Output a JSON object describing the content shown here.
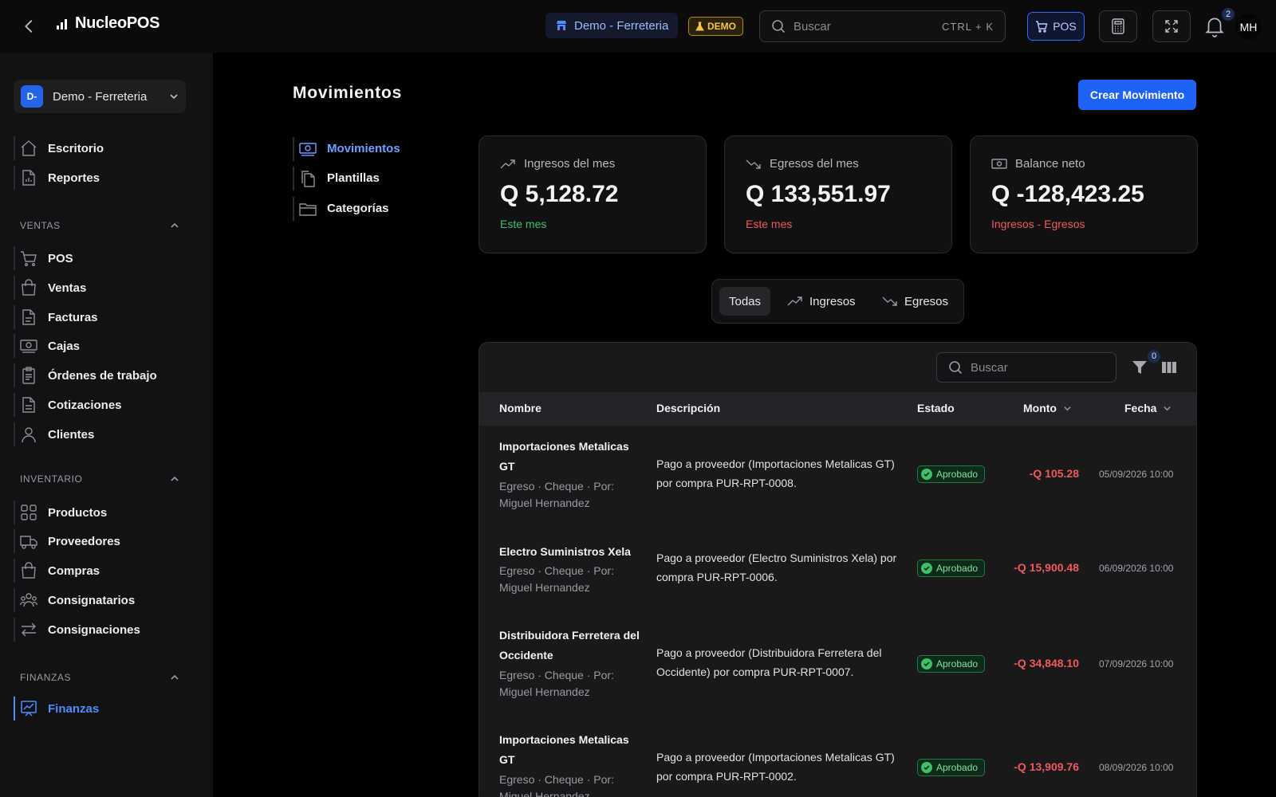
{
  "topbar": {
    "brand": "NucleoPOS",
    "store": "Demo - Ferreteria",
    "demo_badge": "DEMO",
    "search_placeholder": "Buscar",
    "shortcut": "CTRL + K",
    "pos_label": "POS",
    "notifications": "2",
    "avatar": "MH"
  },
  "sidebar": {
    "company": {
      "initials": "D-",
      "name": "Demo - Ferreteria"
    },
    "top_items": [
      {
        "label": "Escritorio",
        "icon": "home-icon"
      },
      {
        "label": "Reportes",
        "icon": "report-icon"
      }
    ],
    "sections": [
      {
        "title": "VENTAS",
        "items": [
          {
            "label": "POS",
            "icon": "cart-icon"
          },
          {
            "label": "Ventas",
            "icon": "bag-icon"
          },
          {
            "label": "Facturas",
            "icon": "invoice-icon"
          },
          {
            "label": "Cajas",
            "icon": "cash-icon"
          },
          {
            "label": "Órdenes de trabajo",
            "icon": "clipboard-icon"
          },
          {
            "label": "Cotizaciones",
            "icon": "document-icon"
          },
          {
            "label": "Clientes",
            "icon": "user-icon"
          }
        ]
      },
      {
        "title": "INVENTARIO",
        "items": [
          {
            "label": "Productos",
            "icon": "grid-icon"
          },
          {
            "label": "Proveedores",
            "icon": "truck-icon"
          },
          {
            "label": "Compras",
            "icon": "bag-icon"
          },
          {
            "label": "Consignatarios",
            "icon": "users-icon"
          },
          {
            "label": "Consignaciones",
            "icon": "arrows-icon"
          }
        ]
      },
      {
        "title": "FINANZAS",
        "items": [
          {
            "label": "Finanzas",
            "icon": "chart-icon"
          }
        ]
      }
    ]
  },
  "page": {
    "title": "Movimientos",
    "create_button": "Crear Movimiento",
    "subnav": [
      {
        "label": "Movimientos",
        "icon": "cash-icon",
        "active": true
      },
      {
        "label": "Plantillas",
        "icon": "copy-icon"
      },
      {
        "label": "Categorías",
        "icon": "folder-icon"
      }
    ]
  },
  "stats": [
    {
      "label": "Ingresos del mes",
      "value": "Q 5,128.72",
      "note": "Este mes",
      "note_color": "#3fbf6a",
      "icon": "trend-up-icon"
    },
    {
      "label": "Egresos del mes",
      "value": "Q 133,551.97",
      "note": "Este mes",
      "note_color": "#ef5a5a",
      "icon": "trend-down-icon"
    },
    {
      "label": "Balance neto",
      "value": "Q -128,423.25",
      "note": "Ingresos - Egresos",
      "note_color": "#ef5a5a",
      "icon": "cash-icon"
    }
  ],
  "filter_tabs": [
    "Todas",
    "Ingresos",
    "Egresos"
  ],
  "table": {
    "search_placeholder": "Buscar",
    "filter_count": "0",
    "columns": [
      "Nombre",
      "Descripción",
      "Estado",
      "Monto",
      "Fecha"
    ],
    "rows": [
      {
        "name": "Importaciones Metalicas GT",
        "meta": "Egreso · Cheque · Por: Miguel Hernandez",
        "description": "Pago a proveedor (Importaciones Metalicas GT) por compra PUR-RPT-0008.",
        "status": "Aprobado",
        "amount": "-Q 105.28",
        "date": "05/09/2026 10:00"
      },
      {
        "name": "Electro Suministros Xela",
        "meta": "Egreso · Cheque · Por: Miguel Hernandez",
        "description": "Pago a proveedor (Electro Suministros Xela) por compra PUR-RPT-0006.",
        "status": "Aprobado",
        "amount": "-Q 15,900.48",
        "date": "06/09/2026 10:00"
      },
      {
        "name": "Distribuidora Ferretera del Occidente",
        "meta": "Egreso · Cheque · Por: Miguel Hernandez",
        "description": "Pago a proveedor (Distribuidora Ferretera del Occidente) por compra PUR-RPT-0007.",
        "status": "Aprobado",
        "amount": "-Q 34,848.10",
        "date": "07/09/2026 10:00"
      },
      {
        "name": "Importaciones Metalicas GT",
        "meta": "Egreso · Cheque · Por: Miguel Hernandez",
        "description": "Pago a proveedor (Importaciones Metalicas GT) por compra PUR-RPT-0002.",
        "status": "Aprobado",
        "amount": "-Q 13,909.76",
        "date": "08/09/2026 10:00"
      }
    ]
  }
}
